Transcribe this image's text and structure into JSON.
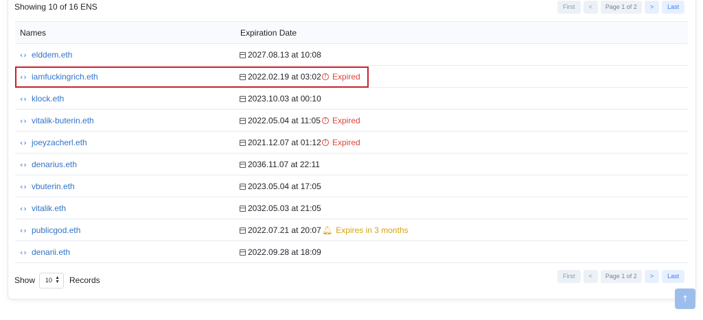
{
  "summary": "Showing 10 of 16 ENS",
  "pagination": {
    "first": "First",
    "prev": "<",
    "page_info": "Page 1 of 2",
    "next": ">",
    "last": "Last"
  },
  "table": {
    "headers": {
      "names": "Names",
      "expiration": "Expiration Date"
    },
    "rows": [
      {
        "name": "elddem.eth",
        "date": "2027.08.13 at 10:08",
        "status": ""
      },
      {
        "name": "iamfuckingrich.eth",
        "date": "2022.02.19 at 03:02",
        "status": "Expired"
      },
      {
        "name": "klock.eth",
        "date": "2023.10.03 at 00:10",
        "status": ""
      },
      {
        "name": "vitalik-buterin.eth",
        "date": "2022.05.04 at 11:05",
        "status": "Expired"
      },
      {
        "name": "joeyzacherl.eth",
        "date": "2021.12.07 at 01:12",
        "status": "Expired"
      },
      {
        "name": "denarius.eth",
        "date": "2036.11.07 at 22:11",
        "status": ""
      },
      {
        "name": "vbuterin.eth",
        "date": "2023.05.04 at 17:05",
        "status": ""
      },
      {
        "name": "vitalik.eth",
        "date": "2032.05.03 at 21:05",
        "status": ""
      },
      {
        "name": "publicgod.eth",
        "date": "2022.07.21 at 20:07",
        "status": "Expires in 3 months"
      },
      {
        "name": "denarii.eth",
        "date": "2022.09.28 at 18:09",
        "status": ""
      }
    ]
  },
  "footer": {
    "show_label": "Show",
    "page_size": "10",
    "records_label": "Records"
  },
  "icons": {
    "name_icon": "code-brackets-icon",
    "date_icon": "calendar-icon",
    "expired_icon": "exclamation-circle-icon",
    "soon_icon": "bell-icon",
    "scroll_icon": "arrow-up-icon"
  },
  "colors": {
    "link": "#3273c6",
    "expired": "#de4437",
    "warning": "#d6a311",
    "highlight_box": "#c8202b"
  }
}
